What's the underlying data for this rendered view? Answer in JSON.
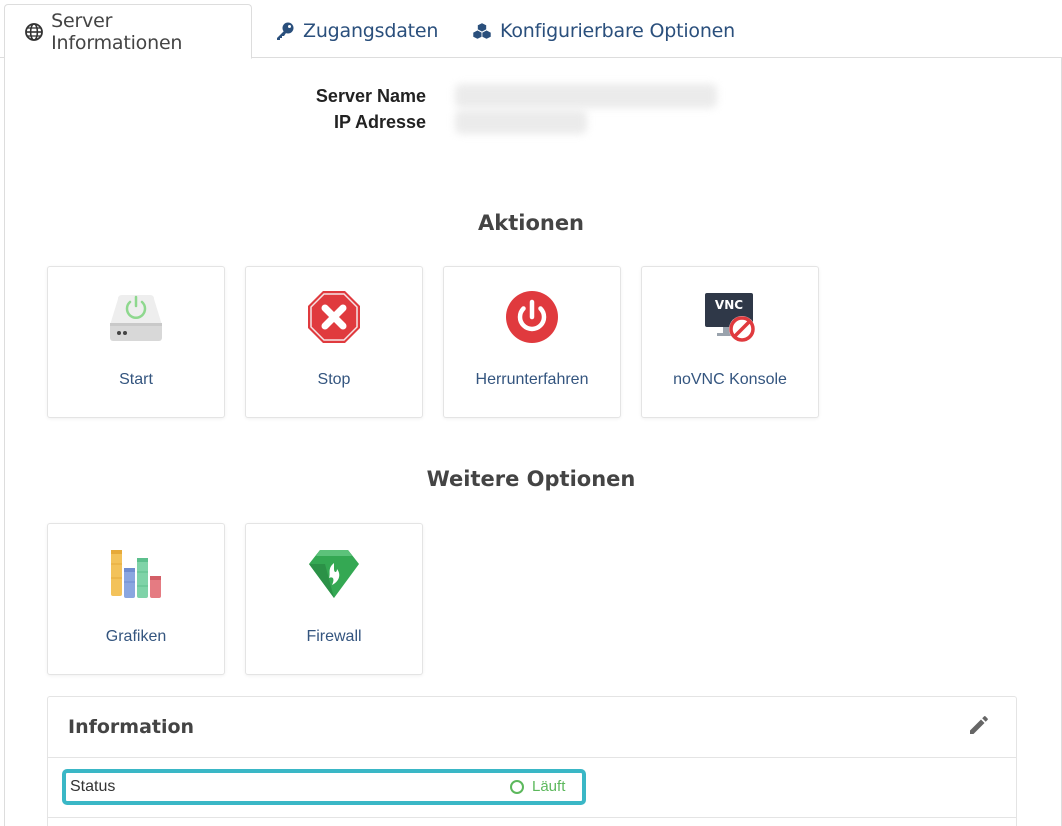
{
  "tabs": [
    {
      "label": "Server Informationen",
      "icon": "globe-icon",
      "active": true
    },
    {
      "label": "Zugangsdaten",
      "icon": "key-icon",
      "active": false
    },
    {
      "label": "Konfigurierbare Optionen",
      "icon": "cubes-icon",
      "active": false
    }
  ],
  "server": {
    "name_label": "Server Name",
    "ip_label": "IP Adresse"
  },
  "sections": {
    "actions_title": "Aktionen",
    "more_title": "Weitere Optionen"
  },
  "actions": [
    {
      "label": "Start",
      "icon": "power-drive-icon"
    },
    {
      "label": "Stop",
      "icon": "stop-octagon-icon"
    },
    {
      "label": "Herrunterfahren",
      "icon": "power-off-icon"
    },
    {
      "label": "noVNC Konsole",
      "icon": "vnc-disabled-icon"
    }
  ],
  "more_options": [
    {
      "label": "Grafiken",
      "icon": "bar-chart-icon"
    },
    {
      "label": "Firewall",
      "icon": "firewall-shield-icon"
    }
  ],
  "information": {
    "title": "Information",
    "edit_icon": "pencil-icon",
    "status_label": "Status",
    "status_value": "Läuft",
    "status_color": "#5cb85c"
  },
  "colors": {
    "link": "#34557f",
    "highlight": "#3ab7c6",
    "danger": "#e03a3e"
  }
}
